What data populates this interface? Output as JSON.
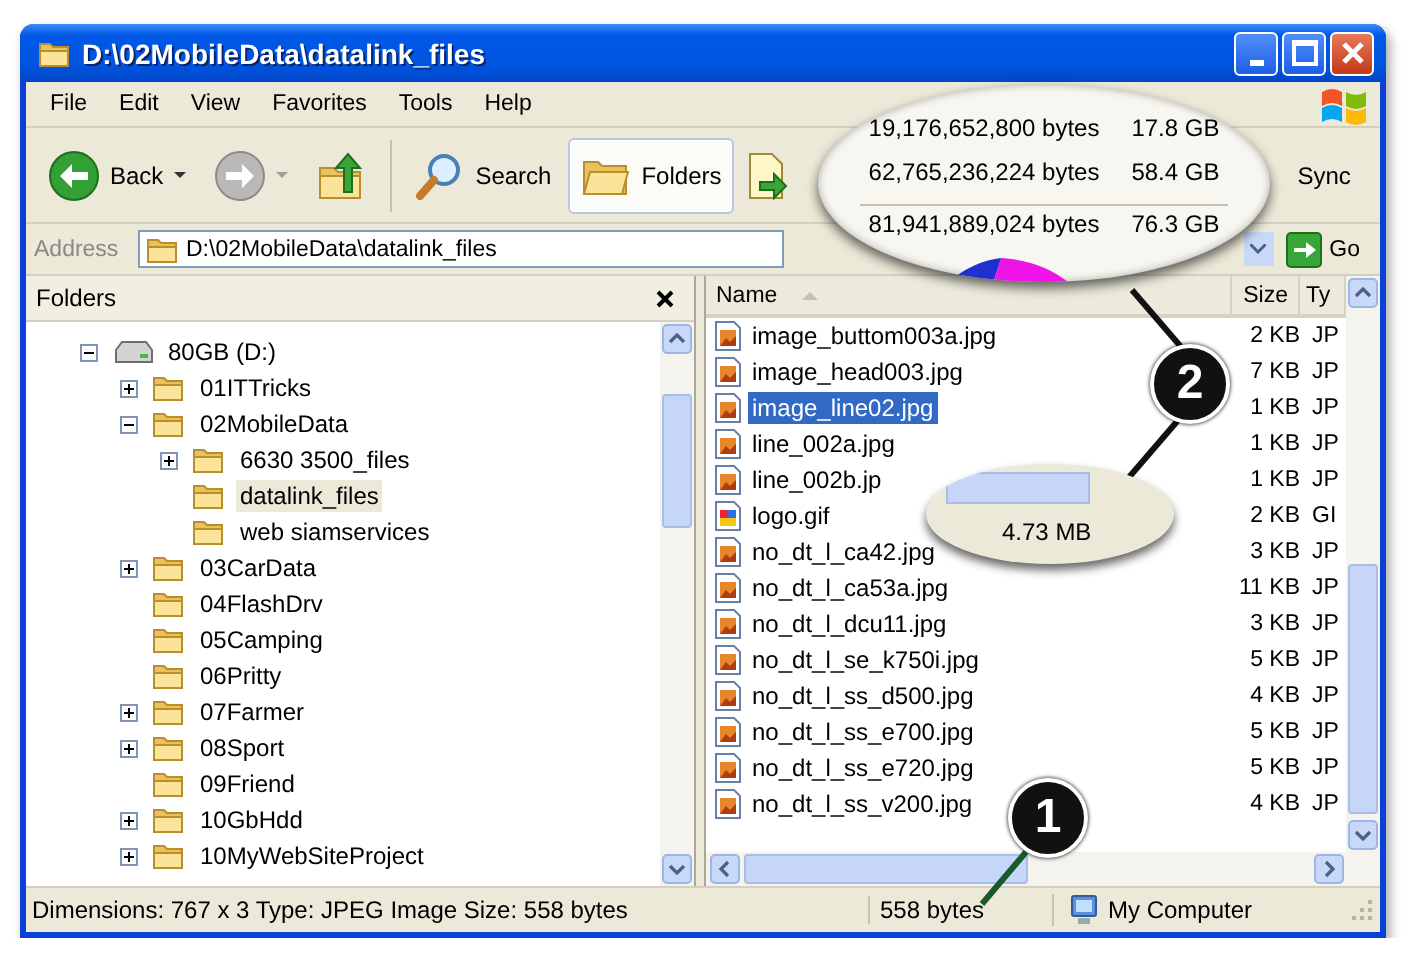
{
  "window": {
    "title": "D:\\02MobileData\\datalink_files"
  },
  "menu": [
    "File",
    "Edit",
    "View",
    "Favorites",
    "Tools",
    "Help"
  ],
  "toolbar": [
    {
      "kind": "back",
      "label": "Back",
      "disabled": false,
      "selected": false
    },
    {
      "kind": "forward",
      "disabled": true,
      "selected": false
    },
    {
      "kind": "up",
      "disabled": false,
      "selected": false
    },
    {
      "kind": "search",
      "label": "Search",
      "disabled": false,
      "selected": false
    },
    {
      "kind": "folders",
      "label": "Folders",
      "disabled": false,
      "selected": true
    },
    {
      "kind": "sync",
      "label": "Sync",
      "disabled": false,
      "selected": false
    }
  ],
  "address": {
    "label": "Address",
    "value": "D:\\02MobileData\\datalink_files",
    "go": "Go"
  },
  "folders_pane": {
    "title": "Folders",
    "tree": [
      {
        "label": "80GB (D:)",
        "kind": "drive",
        "has_children": true,
        "expanded": true,
        "selected": false,
        "children": [
          {
            "label": "01ITTricks",
            "kind": "folder",
            "has_children": true,
            "expanded": false,
            "selected": false
          },
          {
            "label": "02MobileData",
            "kind": "folder",
            "has_children": true,
            "expanded": true,
            "selected": false,
            "children": [
              {
                "label": "6630 3500_files",
                "kind": "folder",
                "has_children": true,
                "expanded": false,
                "selected": false
              },
              {
                "label": "datalink_files",
                "kind": "folder",
                "has_children": false,
                "expanded": false,
                "selected": true
              },
              {
                "label": "web siamservices",
                "kind": "folder",
                "has_children": false,
                "expanded": false,
                "selected": false
              }
            ]
          },
          {
            "label": "03CarData",
            "kind": "folder",
            "has_children": true,
            "expanded": false,
            "selected": false
          },
          {
            "label": "04FlashDrv",
            "kind": "folder",
            "has_children": false,
            "expanded": false,
            "selected": false
          },
          {
            "label": "05Camping",
            "kind": "folder",
            "has_children": false,
            "expanded": false,
            "selected": false
          },
          {
            "label": "06Pritty",
            "kind": "folder",
            "has_children": false,
            "expanded": false,
            "selected": false
          },
          {
            "label": "07Farmer",
            "kind": "folder",
            "has_children": true,
            "expanded": false,
            "selected": false
          },
          {
            "label": "08Sport",
            "kind": "folder",
            "has_children": true,
            "expanded": false,
            "selected": false
          },
          {
            "label": "09Friend",
            "kind": "folder",
            "has_children": false,
            "expanded": false,
            "selected": false
          },
          {
            "label": "10GbHdd",
            "kind": "folder",
            "has_children": true,
            "expanded": false,
            "selected": false
          },
          {
            "label": "10MyWebSiteProject",
            "kind": "folder",
            "has_children": true,
            "expanded": false,
            "selected": false
          }
        ]
      }
    ]
  },
  "file_list": {
    "columns": [
      "Name",
      "Size",
      "Ty"
    ],
    "rows": [
      {
        "name": "image_buttom003a.jpg",
        "size": "2 KB",
        "type": "JP",
        "kind": "jpg",
        "selected": false
      },
      {
        "name": "image_head003.jpg",
        "size": "7 KB",
        "type": "JP",
        "kind": "jpg",
        "selected": false
      },
      {
        "name": "image_line02.jpg",
        "size": "1 KB",
        "type": "JP",
        "kind": "jpg",
        "selected": true
      },
      {
        "name": "line_002a.jpg",
        "size": "1 KB",
        "type": "JP",
        "kind": "jpg",
        "selected": false
      },
      {
        "name": "line_002b.jp",
        "size": "1 KB",
        "type": "JP",
        "kind": "jpg",
        "selected": false
      },
      {
        "name": "logo.gif",
        "size": "2 KB",
        "type": "GI",
        "kind": "gif",
        "selected": false
      },
      {
        "name": "no_dt_l_ca42.jpg",
        "size": "3 KB",
        "type": "JP",
        "kind": "jpg",
        "selected": false
      },
      {
        "name": "no_dt_l_ca53a.jpg",
        "size": "11 KB",
        "type": "JP",
        "kind": "jpg",
        "selected": false
      },
      {
        "name": "no_dt_l_dcu11.jpg",
        "size": "3 KB",
        "type": "JP",
        "kind": "jpg",
        "selected": false
      },
      {
        "name": "no_dt_l_se_k750i.jpg",
        "size": "5 KB",
        "type": "JP",
        "kind": "jpg",
        "selected": false
      },
      {
        "name": "no_dt_l_ss_d500.jpg",
        "size": "4 KB",
        "type": "JP",
        "kind": "jpg",
        "selected": false
      },
      {
        "name": "no_dt_l_ss_e700.jpg",
        "size": "5 KB",
        "type": "JP",
        "kind": "jpg",
        "selected": false
      },
      {
        "name": "no_dt_l_ss_e720.jpg",
        "size": "5 KB",
        "type": "JP",
        "kind": "jpg",
        "selected": false
      },
      {
        "name": "no_dt_l_ss_v200.jpg",
        "size": "4 KB",
        "type": "JP",
        "kind": "jpg",
        "selected": false
      }
    ]
  },
  "callouts": [
    {
      "kind": "disk_usage",
      "rows": [
        {
          "bytes": "19,176,652,800 bytes",
          "size": "17.8 GB",
          "total": false
        },
        {
          "bytes": "62,765,236,224 bytes",
          "size": "58.4 GB",
          "total": false
        },
        {
          "bytes": "81,941,889,024 bytes",
          "size": "76.3 GB",
          "total": true
        }
      ]
    },
    {
      "kind": "status_size",
      "text": "4.73 MB"
    }
  ],
  "markers": [
    "1",
    "2"
  ],
  "status_bar": {
    "details": "Dimensions: 767 x 3 Type: JPEG Image Size: 558 bytes",
    "size": "558 bytes",
    "zone": "My Computer"
  }
}
